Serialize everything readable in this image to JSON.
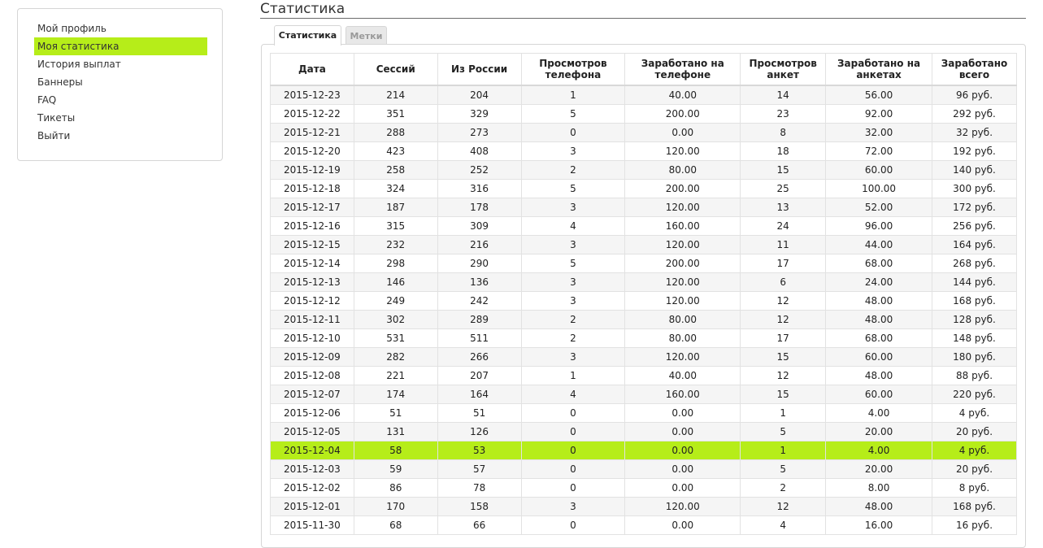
{
  "sidebar": {
    "items": [
      {
        "label": "Мой профиль",
        "active": false
      },
      {
        "label": "Моя статистика",
        "active": true
      },
      {
        "label": "История выплат",
        "active": false
      },
      {
        "label": "Баннеры",
        "active": false
      },
      {
        "label": "FAQ",
        "active": false
      },
      {
        "label": "Тикеты",
        "active": false
      },
      {
        "label": "Выйти",
        "active": false
      }
    ]
  },
  "header": {
    "title": "Статистика"
  },
  "tabs": [
    {
      "label": "Статистика",
      "active": true
    },
    {
      "label": "Метки",
      "active": false
    }
  ],
  "colors": {
    "accent": "#b6ed19"
  },
  "table": {
    "columns": [
      "Дата",
      "Сессий",
      "Из России",
      "Просмотров телефона",
      "Заработано на телефоне",
      "Просмотров анкет",
      "Заработано на анкетах",
      "Заработано всего"
    ],
    "rows": [
      [
        "2015-12-23",
        "214",
        "204",
        "1",
        "40.00",
        "14",
        "56.00",
        "96 руб."
      ],
      [
        "2015-12-22",
        "351",
        "329",
        "5",
        "200.00",
        "23",
        "92.00",
        "292 руб."
      ],
      [
        "2015-12-21",
        "288",
        "273",
        "0",
        "0.00",
        "8",
        "32.00",
        "32 руб."
      ],
      [
        "2015-12-20",
        "423",
        "408",
        "3",
        "120.00",
        "18",
        "72.00",
        "192 руб."
      ],
      [
        "2015-12-19",
        "258",
        "252",
        "2",
        "80.00",
        "15",
        "60.00",
        "140 руб."
      ],
      [
        "2015-12-18",
        "324",
        "316",
        "5",
        "200.00",
        "25",
        "100.00",
        "300 руб."
      ],
      [
        "2015-12-17",
        "187",
        "178",
        "3",
        "120.00",
        "13",
        "52.00",
        "172 руб."
      ],
      [
        "2015-12-16",
        "315",
        "309",
        "4",
        "160.00",
        "24",
        "96.00",
        "256 руб."
      ],
      [
        "2015-12-15",
        "232",
        "216",
        "3",
        "120.00",
        "11",
        "44.00",
        "164 руб."
      ],
      [
        "2015-12-14",
        "298",
        "290",
        "5",
        "200.00",
        "17",
        "68.00",
        "268 руб."
      ],
      [
        "2015-12-13",
        "146",
        "136",
        "3",
        "120.00",
        "6",
        "24.00",
        "144 руб."
      ],
      [
        "2015-12-12",
        "249",
        "242",
        "3",
        "120.00",
        "12",
        "48.00",
        "168 руб."
      ],
      [
        "2015-12-11",
        "302",
        "289",
        "2",
        "80.00",
        "12",
        "48.00",
        "128 руб."
      ],
      [
        "2015-12-10",
        "531",
        "511",
        "2",
        "80.00",
        "17",
        "68.00",
        "148 руб."
      ],
      [
        "2015-12-09",
        "282",
        "266",
        "3",
        "120.00",
        "15",
        "60.00",
        "180 руб."
      ],
      [
        "2015-12-08",
        "221",
        "207",
        "1",
        "40.00",
        "12",
        "48.00",
        "88 руб."
      ],
      [
        "2015-12-07",
        "174",
        "164",
        "4",
        "160.00",
        "15",
        "60.00",
        "220 руб."
      ],
      [
        "2015-12-06",
        "51",
        "51",
        "0",
        "0.00",
        "1",
        "4.00",
        "4 руб."
      ],
      [
        "2015-12-05",
        "131",
        "126",
        "0",
        "0.00",
        "5",
        "20.00",
        "20 руб."
      ],
      [
        "2015-12-04",
        "58",
        "53",
        "0",
        "0.00",
        "1",
        "4.00",
        "4 руб."
      ],
      [
        "2015-12-03",
        "59",
        "57",
        "0",
        "0.00",
        "5",
        "20.00",
        "20 руб."
      ],
      [
        "2015-12-02",
        "86",
        "78",
        "0",
        "0.00",
        "2",
        "8.00",
        "8 руб."
      ],
      [
        "2015-12-01",
        "170",
        "158",
        "3",
        "120.00",
        "12",
        "48.00",
        "168 руб."
      ],
      [
        "2015-11-30",
        "68",
        "66",
        "0",
        "0.00",
        "4",
        "16.00",
        "16 руб."
      ]
    ],
    "highlighted_row": 19
  }
}
